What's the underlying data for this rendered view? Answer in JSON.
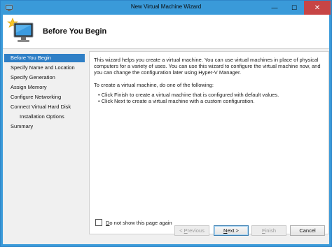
{
  "window": {
    "title": "New Virtual Machine Wizard",
    "controls": {
      "minimize": "—",
      "maximize": "☐",
      "close": "✕"
    }
  },
  "header": {
    "title": "Before You Begin",
    "icon": "new-vm-wizard-icon"
  },
  "sidebar": {
    "items": [
      {
        "label": "Before You Begin",
        "active": true
      },
      {
        "label": "Specify Name and Location"
      },
      {
        "label": "Specify Generation"
      },
      {
        "label": "Assign Memory"
      },
      {
        "label": "Configure Networking"
      },
      {
        "label": "Connect Virtual Hard Disk"
      },
      {
        "label": "Installation Options",
        "sub": true
      },
      {
        "label": "Summary"
      }
    ]
  },
  "content": {
    "intro_line1": "This wizard helps you create a virtual machine. You can use virtual machines in place of physical",
    "intro_line2": "computers for a variety of uses. You can use this wizard to configure the virtual machine now, and",
    "intro_line3": "you can change the configuration later using Hyper-V Manager.",
    "instruction": "To create a virtual machine, do one of the following:",
    "bullets": [
      "Click Finish to create a virtual machine that is configured with default values.",
      "Click Next to create a virtual machine with a custom configuration."
    ],
    "checkbox": {
      "label_u": "D",
      "label_rest": "o not show this page again",
      "checked": false
    }
  },
  "buttons": {
    "previous": {
      "prefix": "< ",
      "u": "P",
      "rest": "revious",
      "enabled": false
    },
    "next": {
      "u": "N",
      "rest": "ext >",
      "enabled": true
    },
    "finish": {
      "u": "F",
      "rest": "inish",
      "enabled": false
    },
    "cancel": {
      "label": "Cancel",
      "enabled": true
    }
  },
  "colors": {
    "titlebar": "#3a9ad9",
    "selection": "#2f7fc6",
    "close_button": "#c74545"
  }
}
